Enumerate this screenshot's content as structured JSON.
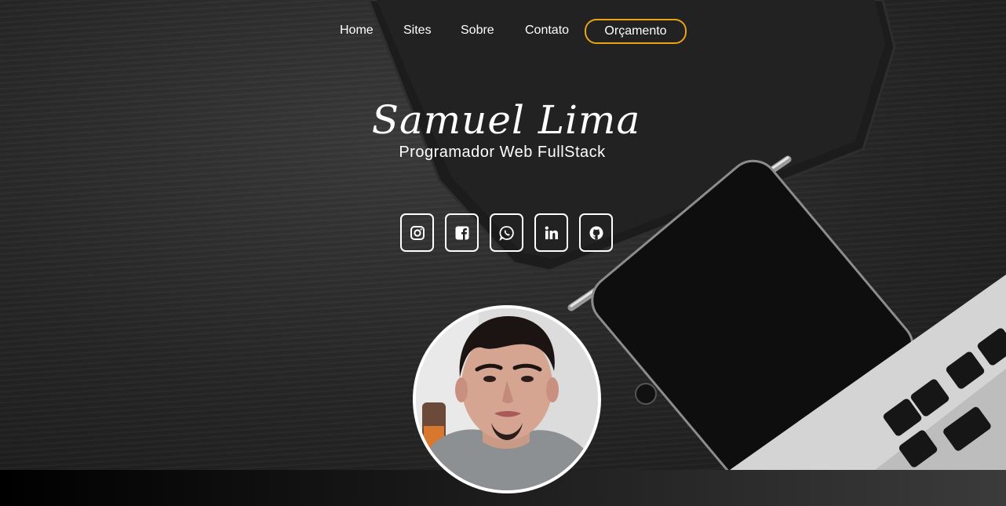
{
  "nav": {
    "items": [
      {
        "label": "Home"
      },
      {
        "label": "Sites"
      },
      {
        "label": "Sobre"
      },
      {
        "label": "Contato"
      }
    ],
    "cta_label": "Orçamento",
    "cta_border_color": "#e8a317"
  },
  "hero": {
    "name": "Samuel Lima",
    "subtitle": "Programador Web FullStack"
  },
  "social": [
    {
      "icon": "instagram-icon"
    },
    {
      "icon": "facebook-icon"
    },
    {
      "icon": "whatsapp-icon"
    },
    {
      "icon": "linkedin-icon"
    },
    {
      "icon": "github-icon"
    }
  ],
  "avatar": {
    "icon": "profile-photo"
  }
}
